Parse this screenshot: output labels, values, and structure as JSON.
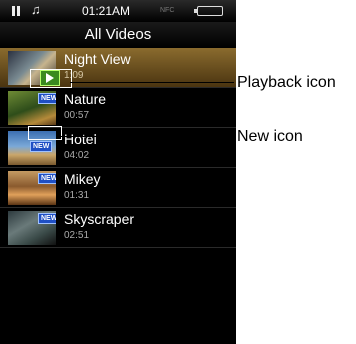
{
  "status_bar": {
    "time": "01:21AM",
    "pause_icon": "pause-icon",
    "music_icon": "music-note-icon",
    "note_glyph": "♫",
    "signal_text": "NFC",
    "battery_icon": "battery-icon"
  },
  "screen": {
    "title": "All Videos"
  },
  "videos": [
    {
      "name": "Night View",
      "duration": "1:09",
      "selected": true,
      "badge": "playback"
    },
    {
      "name": "Nature",
      "duration": "00:57",
      "badge": "new"
    },
    {
      "name": "Hotel",
      "duration": "04:02",
      "badge": "new"
    },
    {
      "name": "Mikey",
      "duration": "01:31",
      "badge": "new"
    },
    {
      "name": "Skyscraper",
      "duration": "02:51",
      "badge": "new"
    }
  ],
  "badges": {
    "new_text": "NEW"
  },
  "callouts": {
    "playback": "Playback icon",
    "new": "New icon"
  },
  "colors": {
    "selected_row": "#8a6b2e",
    "new_badge": "#1f4fc4",
    "playback_badge": "#3a8a1e"
  }
}
